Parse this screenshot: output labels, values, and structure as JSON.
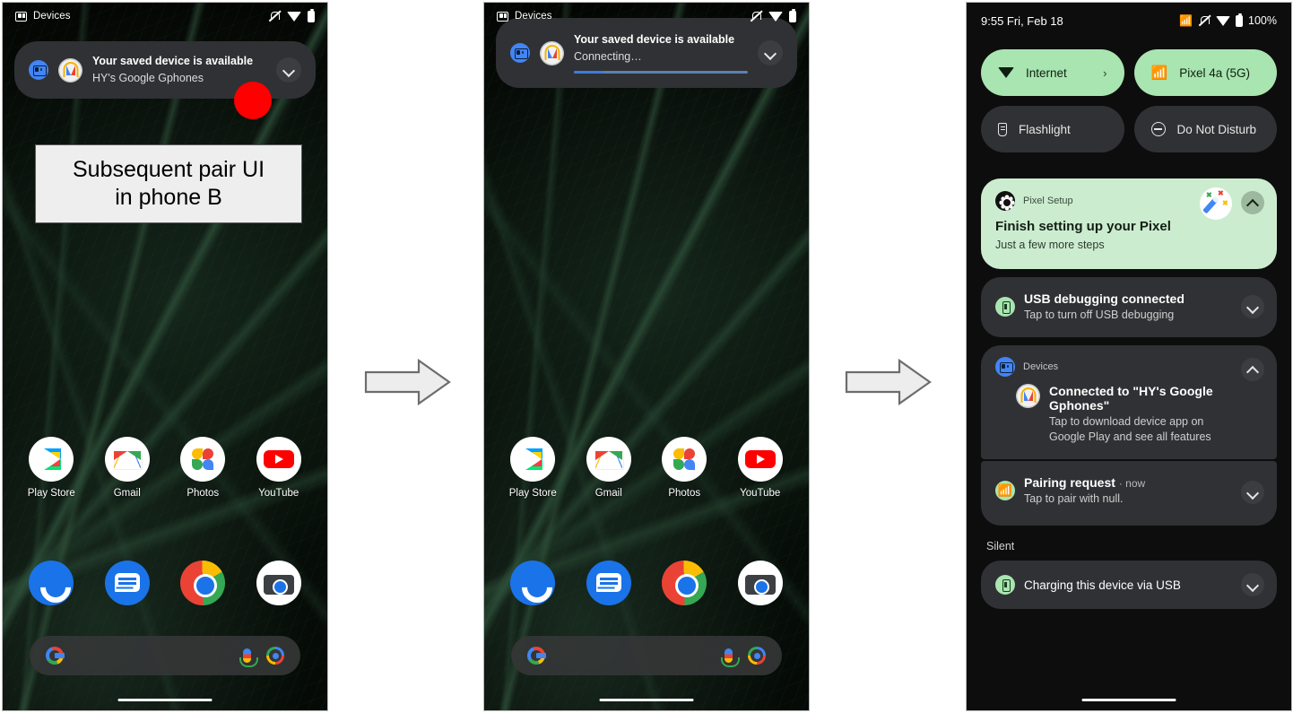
{
  "annotation": {
    "callout_text": "Subsequent pair UI\nin phone B",
    "callout_line1": "Subsequent pair UI",
    "callout_line2": "in phone B"
  },
  "phone_a": {
    "statusbar": {
      "app_label": "Devices",
      "icons": [
        "mute-icon",
        "wifi-icon",
        "battery-icon"
      ]
    },
    "notification": {
      "title": "Your saved device is available",
      "subtitle": "HY's Google Gphones",
      "expand_label": "⌄"
    },
    "apps": [
      {
        "label": "Play Store",
        "icon": "play-store-icon"
      },
      {
        "label": "Gmail",
        "icon": "gmail-icon"
      },
      {
        "label": "Photos",
        "icon": "google-photos-icon"
      },
      {
        "label": "YouTube",
        "icon": "youtube-icon"
      }
    ],
    "dock": [
      {
        "label": "Phone",
        "icon": "phone-icon"
      },
      {
        "label": "Messages",
        "icon": "messages-icon"
      },
      {
        "label": "Chrome",
        "icon": "chrome-icon"
      },
      {
        "label": "Camera",
        "icon": "camera-icon"
      }
    ],
    "search": {
      "logo": "google-g-icon",
      "mic": "microphone-icon",
      "lens": "google-lens-icon"
    }
  },
  "phone_b": {
    "statusbar": {
      "app_label": "Devices",
      "icons": [
        "mute-icon",
        "wifi-icon",
        "battery-icon"
      ]
    },
    "notification": {
      "title": "Your saved device is available",
      "subtitle": "Connecting…",
      "progress_percent": 17
    },
    "apps": [
      {
        "label": "Play Store",
        "icon": "play-store-icon"
      },
      {
        "label": "Gmail",
        "icon": "gmail-icon"
      },
      {
        "label": "Photos",
        "icon": "google-photos-icon"
      },
      {
        "label": "YouTube",
        "icon": "youtube-icon"
      }
    ],
    "dock": [
      {
        "label": "Phone",
        "icon": "phone-icon"
      },
      {
        "label": "Messages",
        "icon": "messages-icon"
      },
      {
        "label": "Chrome",
        "icon": "chrome-icon"
      },
      {
        "label": "Camera",
        "icon": "camera-icon"
      }
    ]
  },
  "phone_c": {
    "statusbar": {
      "time": "9:55 Fri, Feb 18",
      "battery_percent": "100%",
      "icons": [
        "bluetooth-icon",
        "mute-icon",
        "wifi-icon",
        "battery-icon"
      ]
    },
    "quick_settings": [
      {
        "label": "Internet",
        "icon": "wifi-icon",
        "state": "on",
        "chevron": "›"
      },
      {
        "label": "Pixel 4a (5G)",
        "icon": "bluetooth-icon",
        "state": "on"
      },
      {
        "label": "Flashlight",
        "icon": "flashlight-icon",
        "state": "off"
      },
      {
        "label": "Do Not Disturb",
        "icon": "do-not-disturb-icon",
        "state": "off"
      }
    ],
    "notifications": [
      {
        "app": "Pixel Setup",
        "title": "Finish setting up your Pixel",
        "text": "Just a few more steps",
        "icon": "pixel-setup-gear-icon",
        "badge": "magic-wand-icon",
        "style": "green",
        "chevron": "collapse"
      },
      {
        "app": "",
        "title": "USB debugging connected",
        "text": "Tap to turn off USB debugging",
        "icon": "usb-icon",
        "style": "dark",
        "chevron": "expand"
      },
      {
        "app": "Devices",
        "title": "Connected to \"HY's Google Gphones\"",
        "text": "Tap to download device app on Google Play and see all features",
        "icon": "devices-icon",
        "avatar": "device-logo-icon",
        "style": "dark",
        "chevron": "collapse"
      },
      {
        "app": "",
        "title": "Pairing request",
        "title_suffix": "· now",
        "text": "Tap to pair with null.",
        "icon": "bluetooth-icon",
        "style": "dark",
        "chevron": "expand"
      }
    ],
    "silent_section_label": "Silent",
    "silent_notifications": [
      {
        "title": "Charging this device via USB",
        "icon": "usb-icon",
        "chevron": "expand"
      }
    ]
  },
  "flow": {
    "arrows": [
      "arrow-right-1",
      "arrow-right-2"
    ]
  },
  "colors": {
    "accent_green": "#a9e5b0",
    "notif_green": "#ccecd0",
    "notif_dark": "#303134",
    "red_dot": "#fe0000",
    "progress_blue": "#3b7ddd"
  }
}
